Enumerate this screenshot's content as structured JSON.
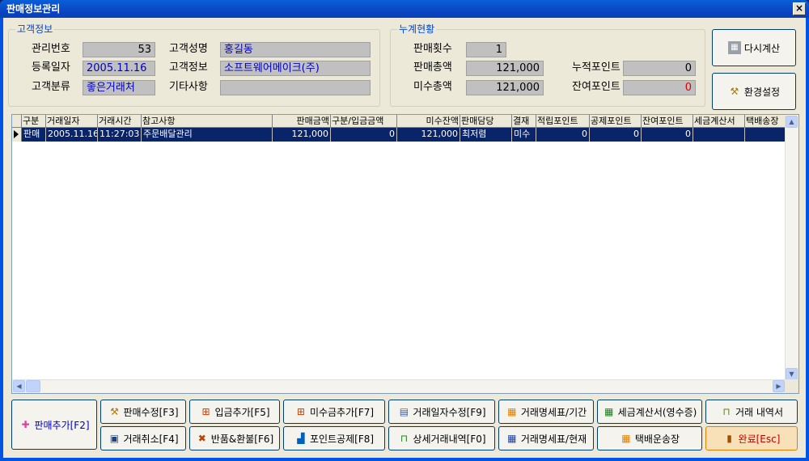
{
  "window": {
    "title": "판매정보관리",
    "close": "×"
  },
  "customer": {
    "group_title": "고객정보",
    "id_label": "관리번호",
    "id_value": "53",
    "name_label": "고객성명",
    "name_value": "홍길동",
    "regdate_label": "등록일자",
    "regdate_value": "2005.11.16",
    "info_label": "고객정보",
    "info_value": "소프트웨어메이크(주)",
    "class_label": "고객분류",
    "class_value": "좋은거래처",
    "etc_label": "기타사항",
    "etc_value": ""
  },
  "summary": {
    "group_title": "누계현황",
    "sales_count_label": "판매횟수",
    "sales_count_value": "1",
    "sales_total_label": "판매총액",
    "sales_total_value": "121,000",
    "unpaid_label": "미수총액",
    "unpaid_value": "121,000",
    "acc_point_label": "누적포인트",
    "acc_point_value": "0",
    "remain_point_label": "잔여포인트",
    "remain_point_value": "0"
  },
  "side_buttons": {
    "recalc": "다시계산",
    "settings": "환경설정"
  },
  "grid": {
    "headers": [
      "구분",
      "거래일자",
      "거래시간",
      "참고사항",
      "판매금액",
      "구분/입금금액",
      "미수잔액",
      "판매담당",
      "결재",
      "적립포인트",
      "공제포인트",
      "잔여포인트",
      "세금계산서",
      "택배송장"
    ],
    "rows": [
      [
        "판매",
        "2005.11.16",
        "11:27:03",
        "주문배달관리",
        "121,000",
        "0",
        "121,000",
        "최저렴",
        "미수",
        "0",
        "0",
        "0",
        "",
        ""
      ]
    ]
  },
  "buttons": {
    "add_sale": "판매추가[F2]",
    "edit_sale": "판매수정[F3]",
    "add_deposit": "입금추가[F5]",
    "add_unpaid": "미수금추가[F7]",
    "edit_date": "거래일자수정[F9]",
    "statement_period": "거래명세표/기간",
    "tax_invoice": "세금계산서(영수증)",
    "history": "거래 내역서",
    "cancel": "거래취소[F4]",
    "return": "반품&환불[F6]",
    "point_deduct": "포인트공제[F8]",
    "detail": "상세거래내역[F0]",
    "statement_current": "거래명세표/현재",
    "delivery": "택배운송장",
    "done": "완료[Esc]"
  },
  "colors": {
    "selection": "#0a246a",
    "accent_text": "#0046d5",
    "alert": "#e00000"
  }
}
